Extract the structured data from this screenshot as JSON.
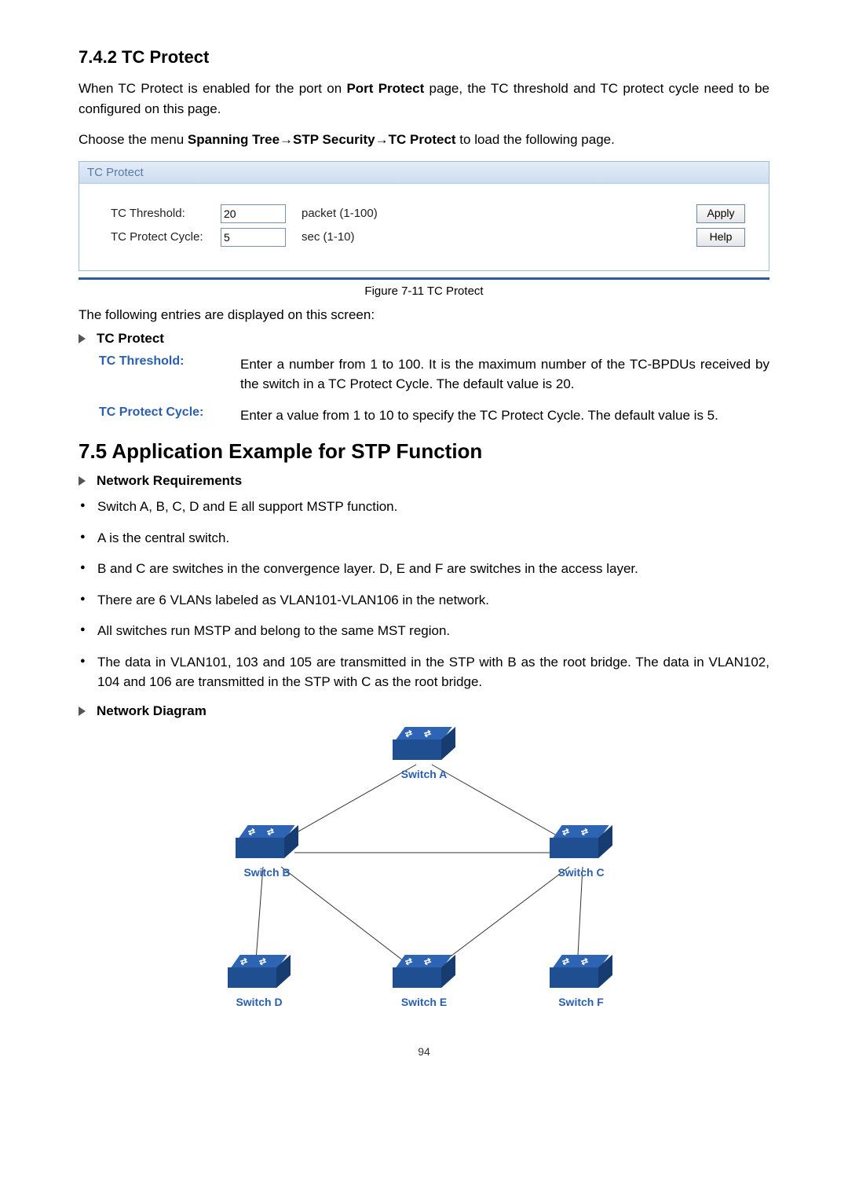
{
  "heading_742": "7.4.2 TC Protect",
  "intro_para": "When TC Protect is enabled for the port on Port Protect page, the TC threshold and TC protect cycle need to be configured on this page.",
  "intro_bold1": "Port Protect",
  "menu_para_prefix": "Choose the menu ",
  "menu_path": "Spanning Tree→STP Security→TC Protect",
  "menu_para_suffix": " to load the following page.",
  "panel": {
    "title": "TC Protect",
    "threshold_label": "TC Threshold:",
    "threshold_value": "20",
    "threshold_hint": "packet (1-100)",
    "cycle_label": "TC Protect Cycle:",
    "cycle_value": "5",
    "cycle_hint": "sec (1-10)",
    "apply": "Apply",
    "help": "Help"
  },
  "figure_caption": "Figure 7-11 TC Protect",
  "entries_intro": "The following entries are displayed on this screen:",
  "entries_heading": "TC Protect",
  "defs": [
    {
      "term": "TC Threshold:",
      "desc": "Enter a number from 1 to 100. It is the maximum number of the TC-BPDUs received by the switch in a TC Protect Cycle. The default value is 20."
    },
    {
      "term": "TC Protect Cycle:",
      "desc": "Enter a value from 1 to 10 to specify the TC Protect Cycle. The default value is 5."
    }
  ],
  "heading_75": "7.5  Application Example for STP Function",
  "net_req_h": "Network Requirements",
  "req_bullets": [
    "Switch A, B, C, D and E all support MSTP function.",
    "A is the central switch.",
    "B and C are switches in the convergence layer. D, E and F are switches in the access layer.",
    "There are 6 VLANs labeled as VLAN101-VLAN106 in the network.",
    "All switches run MSTP and belong to the same MST region.",
    "The data in VLAN101, 103 and 105 are transmitted in the STP with B as the root bridge. The data in VLAN102, 104 and 106 are transmitted in the STP with C as the root bridge."
  ],
  "net_diag_h": "Network Diagram",
  "switch_labels": {
    "A": "Switch A",
    "B": "Switch B",
    "C": "Switch C",
    "D": "Switch D",
    "E": "Switch E",
    "F": "Switch F"
  },
  "page_number": "94"
}
